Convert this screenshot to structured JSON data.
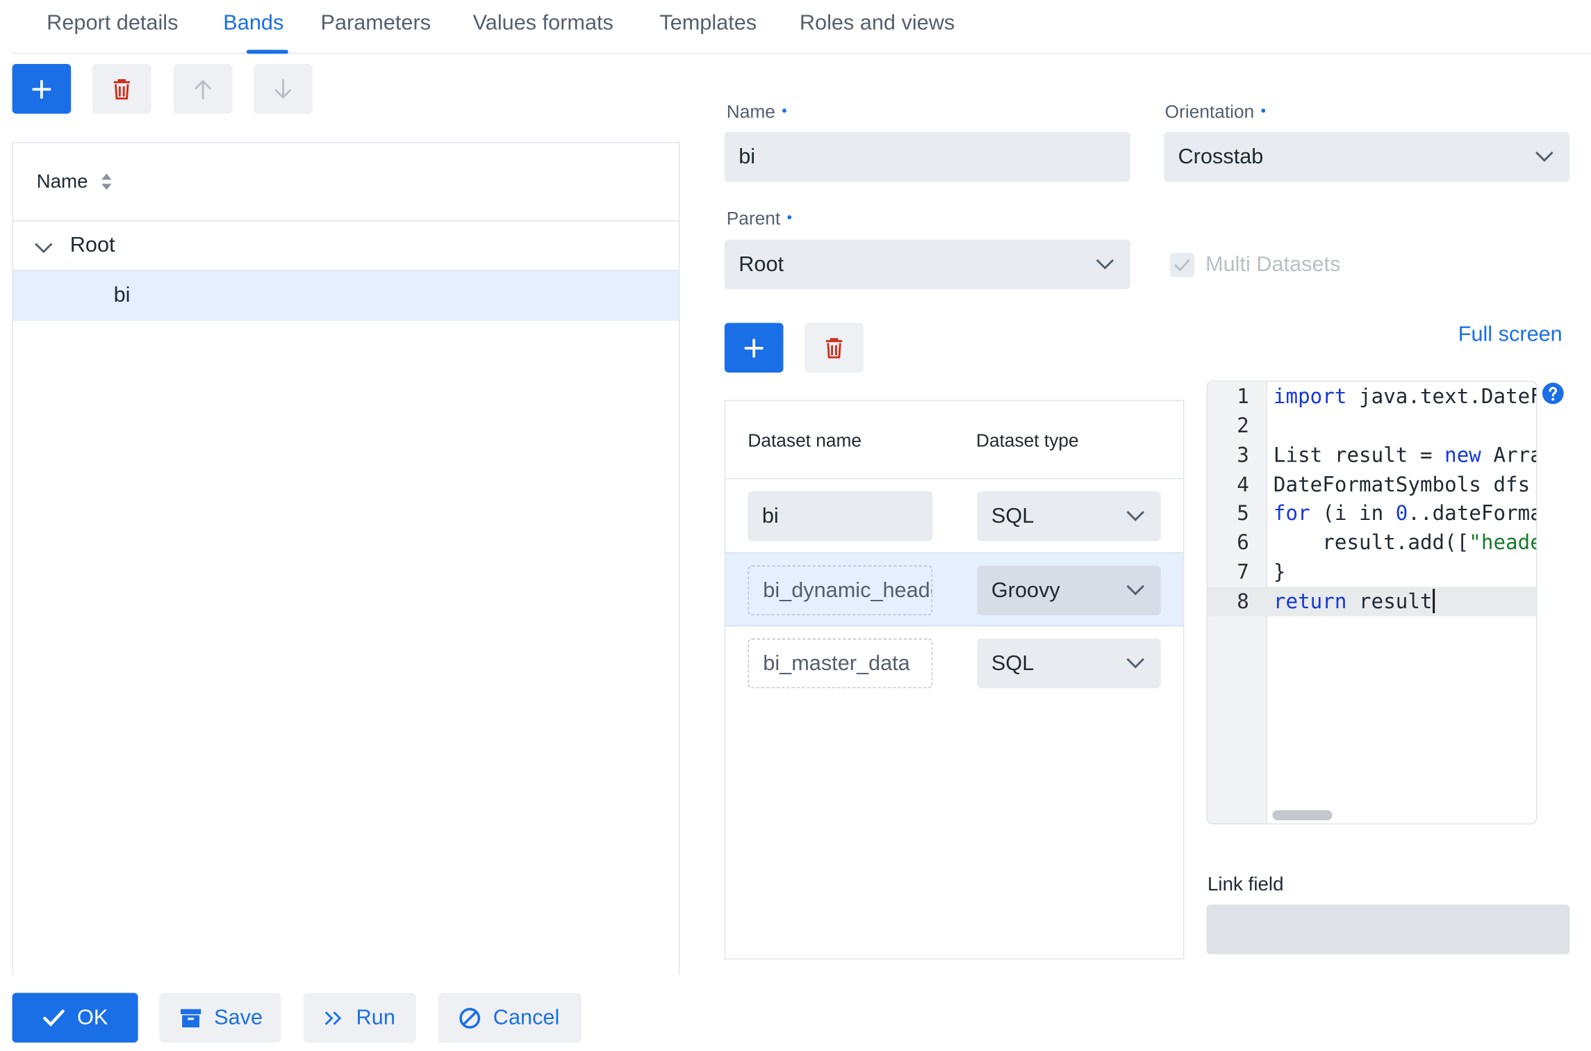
{
  "tabs": [
    {
      "label": "Report details",
      "active": false
    },
    {
      "label": "Bands",
      "active": true
    },
    {
      "label": "Parameters",
      "active": false
    },
    {
      "label": "Values formats",
      "active": false
    },
    {
      "label": "Templates",
      "active": false
    },
    {
      "label": "Roles and views",
      "active": false
    }
  ],
  "toolbar": {
    "icons": [
      "plus-icon",
      "trash-icon",
      "arrow-up-icon",
      "arrow-down-icon"
    ]
  },
  "tree": {
    "header": "Name",
    "root": {
      "label": "Root",
      "expanded": true
    },
    "children": [
      {
        "label": "bi",
        "selected": true
      }
    ]
  },
  "form": {
    "name": {
      "label": "Name",
      "value": "bi"
    },
    "orientation": {
      "label": "Orientation",
      "value": "Crosstab"
    },
    "parent": {
      "label": "Parent",
      "value": "Root"
    },
    "multi_datasets": {
      "label": "Multi Datasets",
      "checked": true,
      "disabled": true
    },
    "full_screen_link": "Full screen",
    "link_field": {
      "label": "Link field",
      "value": ""
    }
  },
  "datasets": {
    "columns": [
      "Dataset name",
      "Dataset type"
    ],
    "rows": [
      {
        "name": "bi",
        "type": "SQL",
        "selected": false
      },
      {
        "name": "bi_dynamic_header",
        "type": "Groovy",
        "selected": true
      },
      {
        "name": "bi_master_data",
        "type": "SQL",
        "selected": false
      }
    ]
  },
  "editor": {
    "line_numbers": [
      "1",
      "2",
      "3",
      "4",
      "5",
      "6",
      "7",
      "8"
    ],
    "lines": {
      "l1_kw": "import",
      "l1_rest": " java.text.DateFormatSymbols",
      "l3_a": "List result = ",
      "l3_kw": "new",
      "l3_b": " ArrayList()",
      "l4": "DateFormatSymbols dfs",
      "l5_kw": "for",
      "l5_a": " (i in ",
      "l5_num": "0",
      "l5_b": "..dateFormat",
      "l6_a": "    result.add([",
      "l6_str": "\"header\"",
      "l7": "}",
      "l8_kw": "return",
      "l8_rest": " result"
    }
  },
  "footer": {
    "ok": "OK",
    "save": "Save",
    "run": "Run",
    "cancel": "Cancel"
  },
  "colors": {
    "accent": "#1a6fe6",
    "danger": "#c8321e",
    "selected_row": "#e5efff"
  }
}
